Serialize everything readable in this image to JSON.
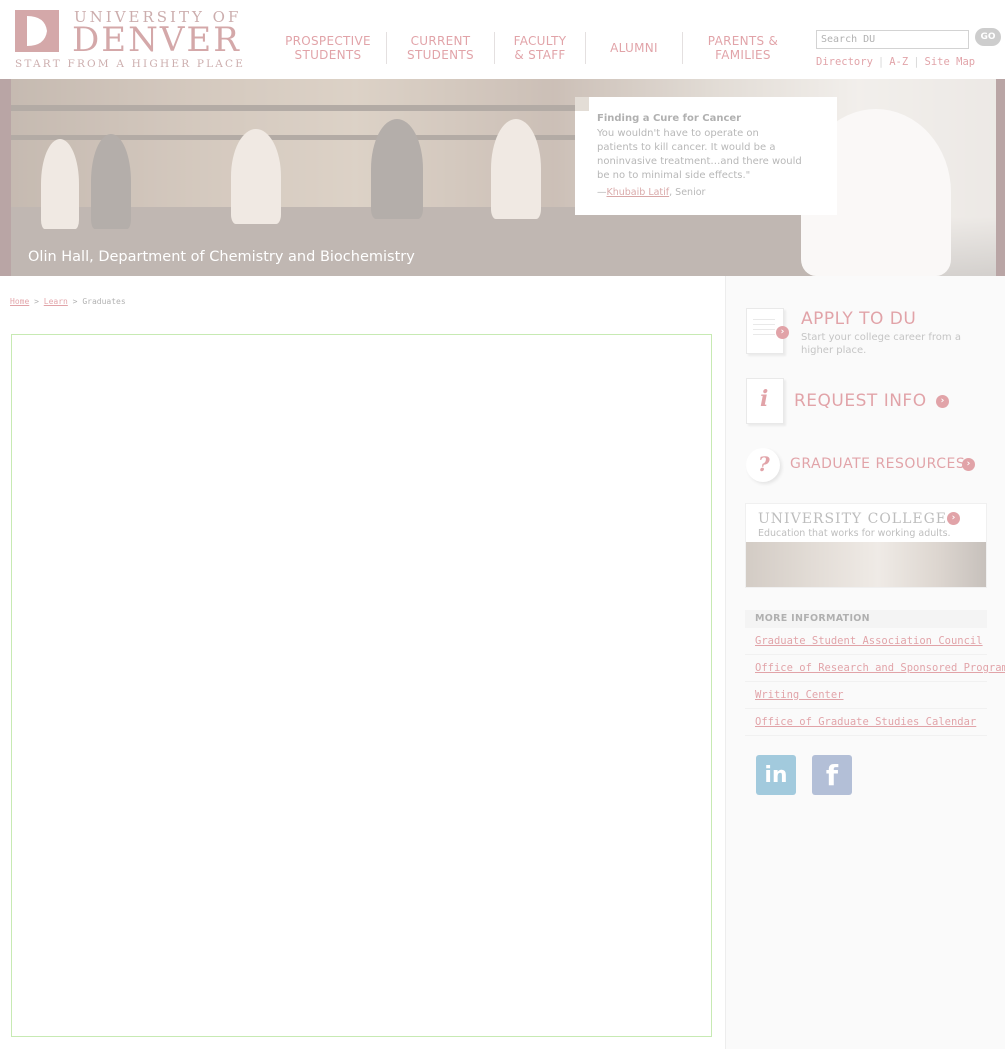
{
  "logo": {
    "top": "UNIVERSITY OF",
    "main": "DENVER",
    "tagline": "START FROM A HIGHER PLACE"
  },
  "nav": {
    "items": [
      {
        "label": "PROSPECTIVE\nSTUDENTS"
      },
      {
        "label": "CURRENT\nSTUDENTS"
      },
      {
        "label": "FACULTY\n& STAFF"
      },
      {
        "label": "ALUMNI"
      },
      {
        "label": "PARENTS &\nFAMILIES"
      }
    ]
  },
  "search": {
    "value": "Search DU",
    "go_label": "GO"
  },
  "utility": {
    "directory": "Directory",
    "az": "A-Z",
    "sitemap": "Site Map",
    "separator": "|"
  },
  "banner": {
    "caption": "Olin Hall, Department of Chemistry and Biochemistry",
    "quote_title": "Finding a Cure for Cancer",
    "quote_body": "You wouldn't have to operate on patients to kill cancer. It would be a noninvasive treatment…and there would be no to minimal side effects.\"",
    "quote_dash": "—",
    "quote_name": "Khubaib Latif",
    "quote_role": ", Senior"
  },
  "breadcrumb": {
    "home": "Home",
    "learn": "Learn",
    "current": "Graduates",
    "sep": ">"
  },
  "sidebar": {
    "apply_title": "APPLY TO DU",
    "apply_sub": "Start your college career from a higher place.",
    "request_title": "REQUEST INFO",
    "grad_title": "GRADUATE RESOURCES",
    "uc_title": "UNIVERSITY COLLEGE",
    "uc_sub": "Education that works for working adults.",
    "more_heading": "MORE INFORMATION",
    "more_links": [
      "Graduate Student Association Council",
      "Office of Research and Sponsored Programs",
      "Writing Center",
      "Office of Graduate Studies Calendar"
    ],
    "linkedin_label": "in",
    "facebook_label": "f"
  },
  "colors": {
    "brand_red": "#b30f1d",
    "frame_green": "#6ec93a",
    "linkedin": "#0e76a8",
    "facebook": "#3b5998"
  }
}
